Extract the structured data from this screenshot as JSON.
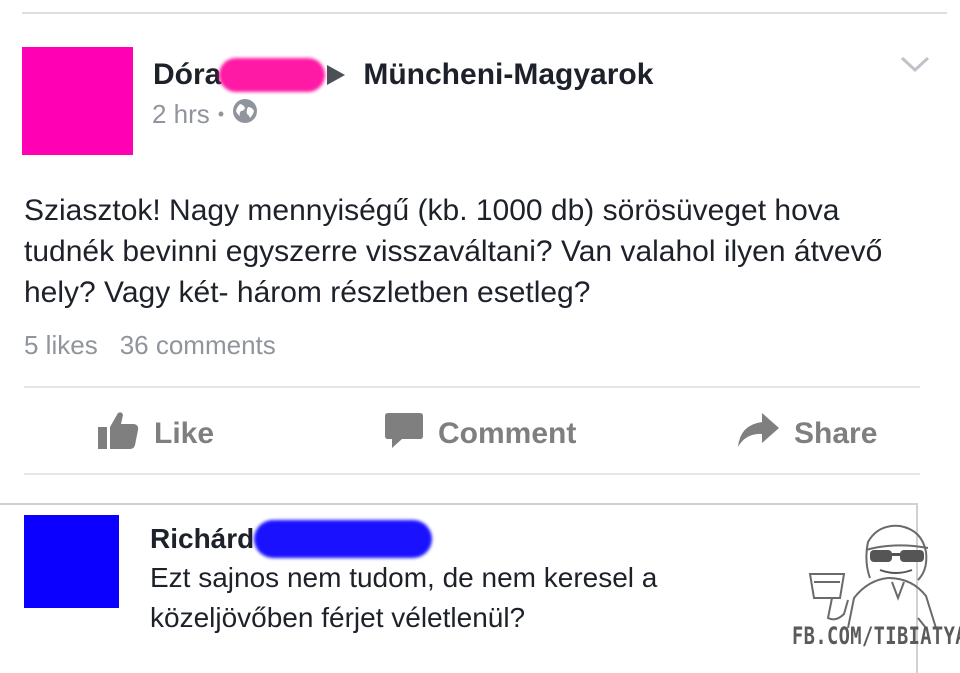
{
  "post": {
    "author": "Dóra",
    "target_group": "Müncheni-Magyarok",
    "time": "2 hrs",
    "separator": "•",
    "privacy_icon": "globe-icon",
    "avatar_color": "#ff00b4",
    "text": "Sziasztok! Nagy mennyiségű (kb. 1000 db) sörösüveget hova tudnék bevinni egyszerre visszaváltani? Van valahol ilyen átvevő hely? Vagy két- három részletben esetleg?",
    "likes": "5 likes",
    "comments": "36 comments"
  },
  "actions": {
    "like_label": "Like",
    "comment_label": "Comment",
    "share_label": "Share"
  },
  "comment": {
    "author": "Richárd",
    "avatar_color": "#0b00ff",
    "text": "Ezt sajnos nem tudom, de nem keresel a közeljövőben férjet véletlenül?"
  },
  "watermark": {
    "text": "FB.COM/TIBIATYA"
  }
}
